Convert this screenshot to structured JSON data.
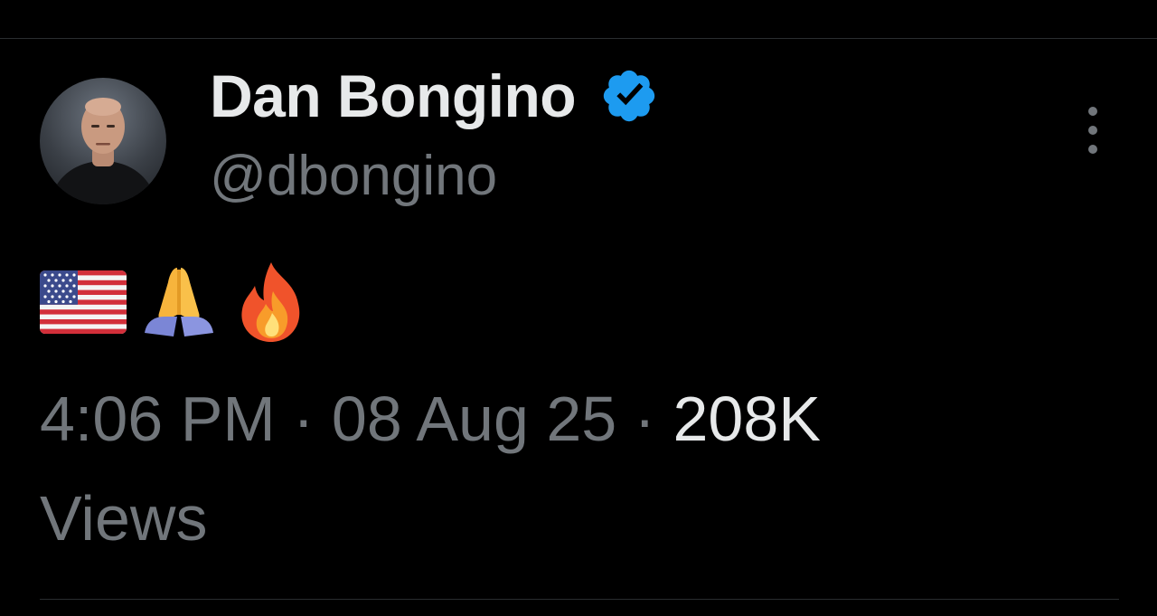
{
  "tweet": {
    "author": {
      "display_name": "Dan Bongino",
      "handle": "@dbongino",
      "verified": true,
      "avatar_icon": "profile-photo"
    },
    "body_emojis": [
      "us-flag-emoji",
      "folded-hands-emoji",
      "fire-emoji"
    ],
    "timestamp": {
      "time": "4:06 PM",
      "separator1": " · ",
      "date": "08 Aug 25",
      "separator2": " · ",
      "views_count": "208K",
      "views_label": "Views"
    },
    "more_icon": "more-vertical-icon"
  },
  "colors": {
    "background": "#000000",
    "primary_text": "#e7e9ea",
    "secondary_text": "#71767b",
    "verified_blue": "#1d9bf0",
    "divider": "#2a2d30"
  }
}
